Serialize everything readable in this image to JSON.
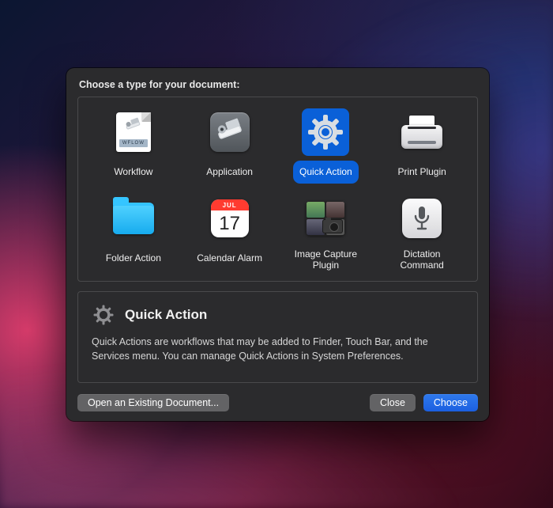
{
  "prompt": "Choose a type for your document:",
  "types": [
    {
      "label": "Workflow",
      "icon": "workflow-icon",
      "selected": false,
      "caption": "WFLOW"
    },
    {
      "label": "Application",
      "icon": "application-icon",
      "selected": false
    },
    {
      "label": "Quick Action",
      "icon": "quick-action-icon",
      "selected": true
    },
    {
      "label": "Print Plugin",
      "icon": "print-plugin-icon",
      "selected": false
    },
    {
      "label": "Folder Action",
      "icon": "folder-action-icon",
      "selected": false
    },
    {
      "label": "Calendar Alarm",
      "icon": "calendar-alarm-icon",
      "selected": false,
      "month": "JUL",
      "day": "17"
    },
    {
      "label": "Image Capture Plugin",
      "icon": "image-capture-icon",
      "selected": false
    },
    {
      "label": "Dictation Command",
      "icon": "dictation-icon",
      "selected": false
    }
  ],
  "info": {
    "title": "Quick Action",
    "description": "Quick Actions are workflows that may be added to Finder, Touch Bar, and the Services menu. You can manage Quick Actions in System Preferences."
  },
  "footer": {
    "open_existing": "Open an Existing Document...",
    "close": "Close",
    "choose": "Choose"
  }
}
